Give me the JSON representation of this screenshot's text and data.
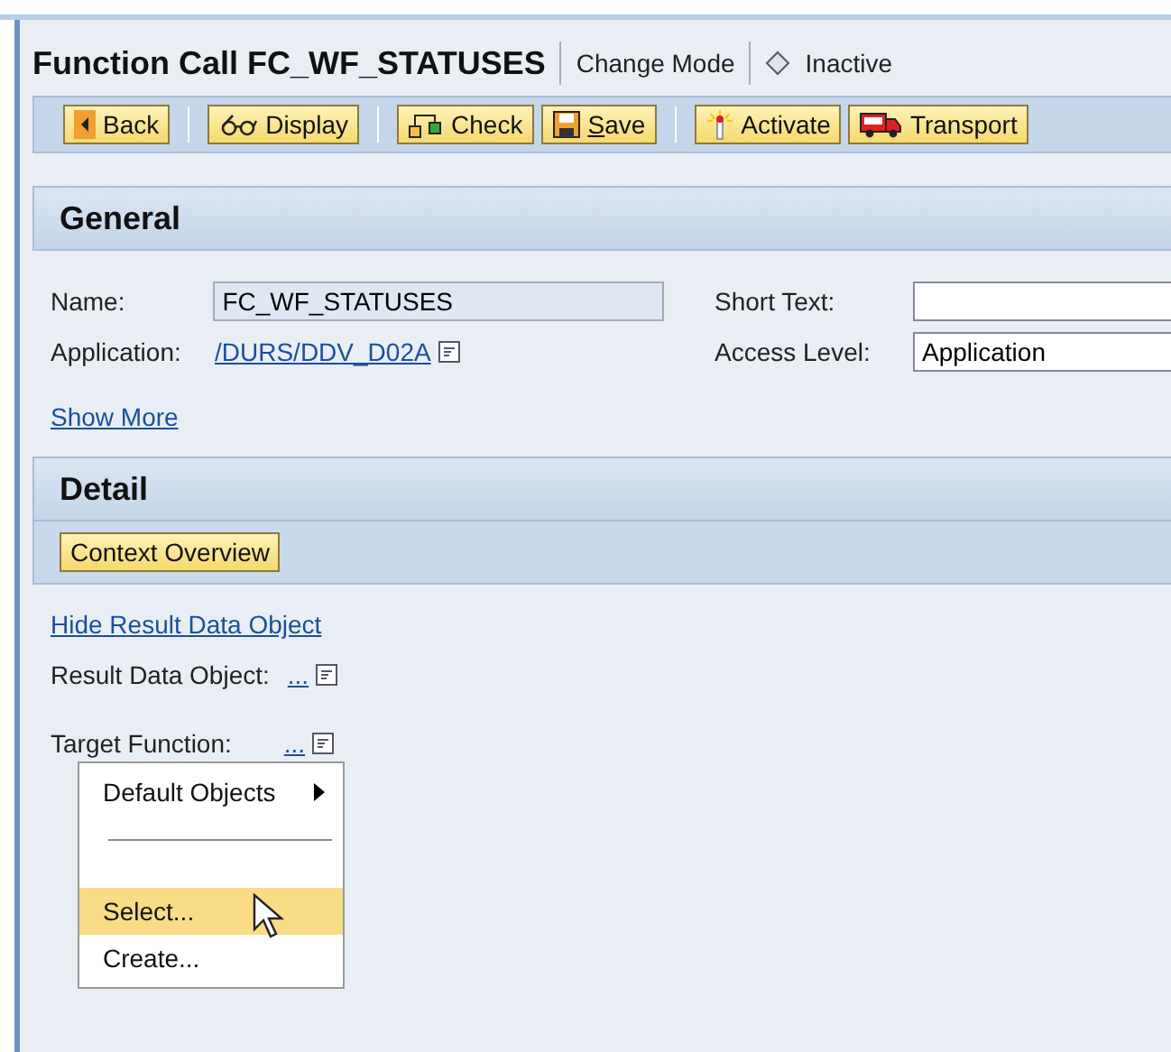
{
  "header": {
    "title": "Function Call FC_WF_STATUSES",
    "mode": "Change Mode",
    "status": "Inactive"
  },
  "toolbar": {
    "groups": [
      [
        "Back"
      ],
      [
        "Display"
      ],
      [
        "Check",
        "Save"
      ],
      [
        "Activate",
        "Transport"
      ]
    ]
  },
  "general": {
    "title": "General",
    "name": {
      "label": "Name:",
      "value": "FC_WF_STATUSES"
    },
    "application": {
      "label": "Application:",
      "value": "/DURS/DDV_D02A"
    },
    "short_text": {
      "label": "Short Text:"
    },
    "access_level": {
      "label": "Access Level:",
      "value": "Application"
    },
    "show_more": "Show More"
  },
  "detail": {
    "title": "Detail",
    "button": "Context Overview",
    "hide_link": "Hide Result Data Object",
    "result": {
      "label": "Result Data Object:",
      "link": "..."
    },
    "target": {
      "label": "Target Function:",
      "link": "..."
    }
  },
  "menu": {
    "items": [
      {
        "kind": "submenu",
        "label": "Default Objects",
        "selected": false
      },
      {
        "kind": "separator"
      },
      {
        "kind": "item",
        "label": "Select...",
        "selected": true
      },
      {
        "kind": "item",
        "label": "Create...",
        "selected": false
      }
    ]
  }
}
